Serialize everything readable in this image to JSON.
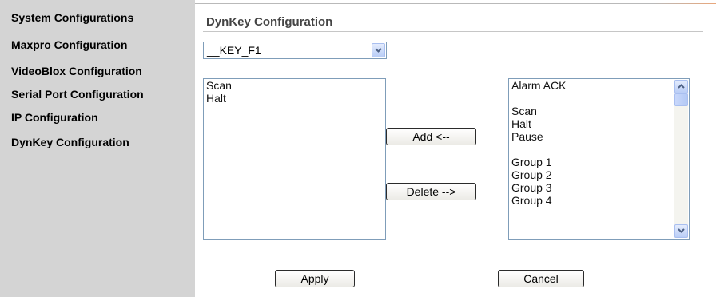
{
  "sidebar": {
    "items": [
      {
        "label": "System Configurations"
      },
      {
        "label": "Maxpro Configuration"
      },
      {
        "label": "VideoBlox Configuration"
      },
      {
        "label": "Serial Port Configuration"
      },
      {
        "label": "IP Configuration"
      },
      {
        "label": "DynKey Configuration"
      }
    ]
  },
  "main": {
    "title": "DynKey Configuration",
    "key_select": {
      "value": "__KEY_F1"
    },
    "assigned_list": [
      "Scan",
      "Halt"
    ],
    "available_list": [
      "Alarm ACK",
      "",
      "Scan",
      "Halt",
      "Pause",
      "",
      "Group 1",
      "Group 2",
      "Group 3",
      "Group 4"
    ],
    "add_label": "Add <--",
    "delete_label": "Delete -->",
    "apply_label": "Apply",
    "cancel_label": "Cancel"
  }
}
